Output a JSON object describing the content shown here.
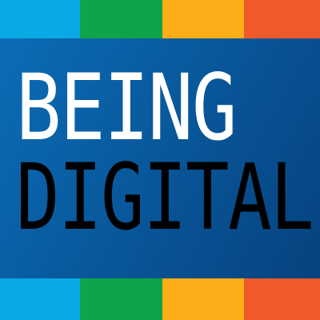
{
  "logo": {
    "line1": "BEING",
    "line2": "DIGITAL"
  },
  "colors": {
    "banner_light": "#0b6cb6",
    "banner_dark": "#06427e",
    "line1_text": "#ffffff",
    "line2_text": "#000000",
    "stripes": [
      "#0aa9e6",
      "#10a44a",
      "#fbae17",
      "#ef5a2a"
    ]
  }
}
